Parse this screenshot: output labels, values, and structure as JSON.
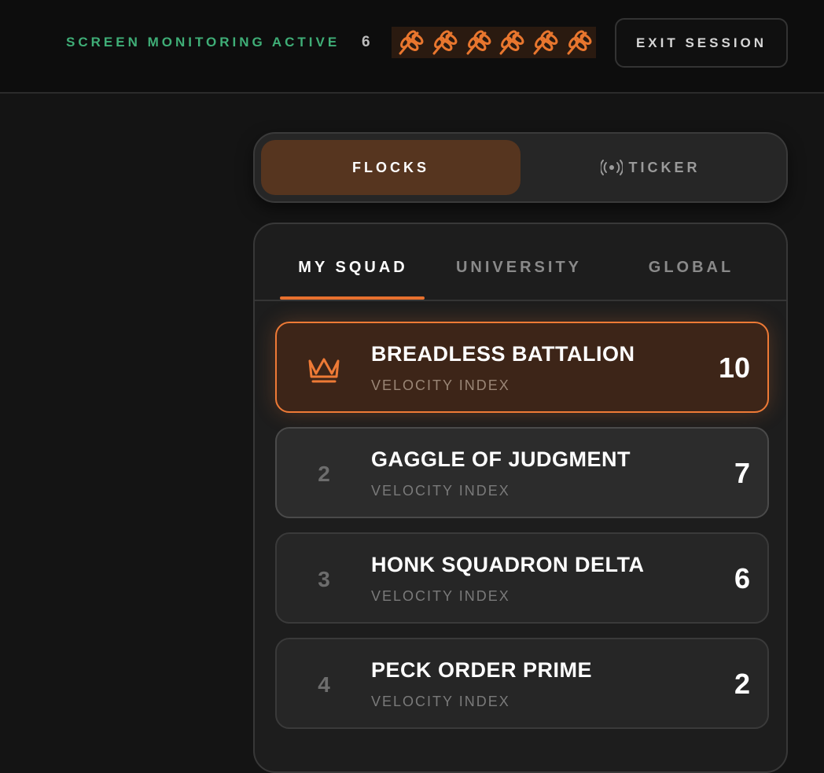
{
  "header": {
    "monitor_label": "SCREEN MONITORING ACTIVE",
    "grain_count": "6",
    "grain_icons": 6,
    "grain_color": "#e8762e",
    "exit_label": "EXIT SESSION"
  },
  "switcher": {
    "flocks_label": "FLOCKS",
    "ticker_label": "TICKER",
    "active": "FLOCKS"
  },
  "board": {
    "tabs": [
      {
        "label": "MY SQUAD",
        "active": true
      },
      {
        "label": "UNIVERSITY",
        "active": false
      },
      {
        "label": "GLOBAL",
        "active": false
      }
    ],
    "rows": [
      {
        "rank": "1",
        "icon": "crown-icon",
        "name": "BREADLESS BATTALION",
        "sub": "VELOCITY INDEX",
        "score": "10"
      },
      {
        "rank": "2",
        "name": "GAGGLE OF JUDGMENT",
        "sub": "VELOCITY INDEX",
        "score": "7"
      },
      {
        "rank": "3",
        "name": "HONK SQUADRON DELTA",
        "sub": "VELOCITY INDEX",
        "score": "6"
      },
      {
        "rank": "4",
        "name": "PECK ORDER PRIME",
        "sub": "VELOCITY INDEX",
        "score": "2"
      }
    ]
  },
  "colors": {
    "accent": "#ee7a36",
    "monitor_green": "#3fae77",
    "active_segment": "#56351f"
  }
}
